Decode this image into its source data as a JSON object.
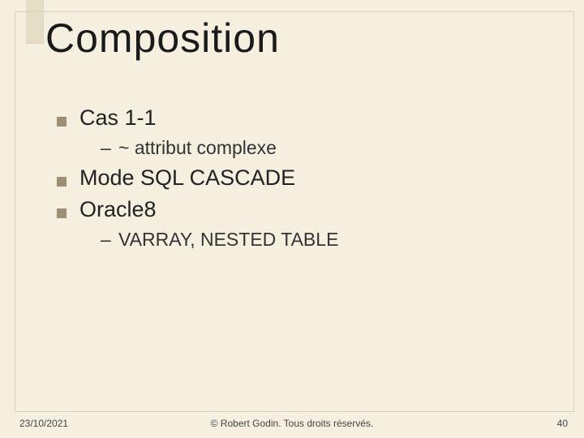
{
  "title": "Composition",
  "bullets": {
    "l1_0": "Cas 1-1",
    "l2_0": "~ attribut complexe",
    "l1_1": "Mode SQL CASCADE",
    "l1_2": "Oracle8",
    "l2_1": "VARRAY, NESTED TABLE"
  },
  "footer": {
    "date": "23/10/2021",
    "copyright": "© Robert Godin. Tous droits réservés.",
    "page": "40"
  }
}
